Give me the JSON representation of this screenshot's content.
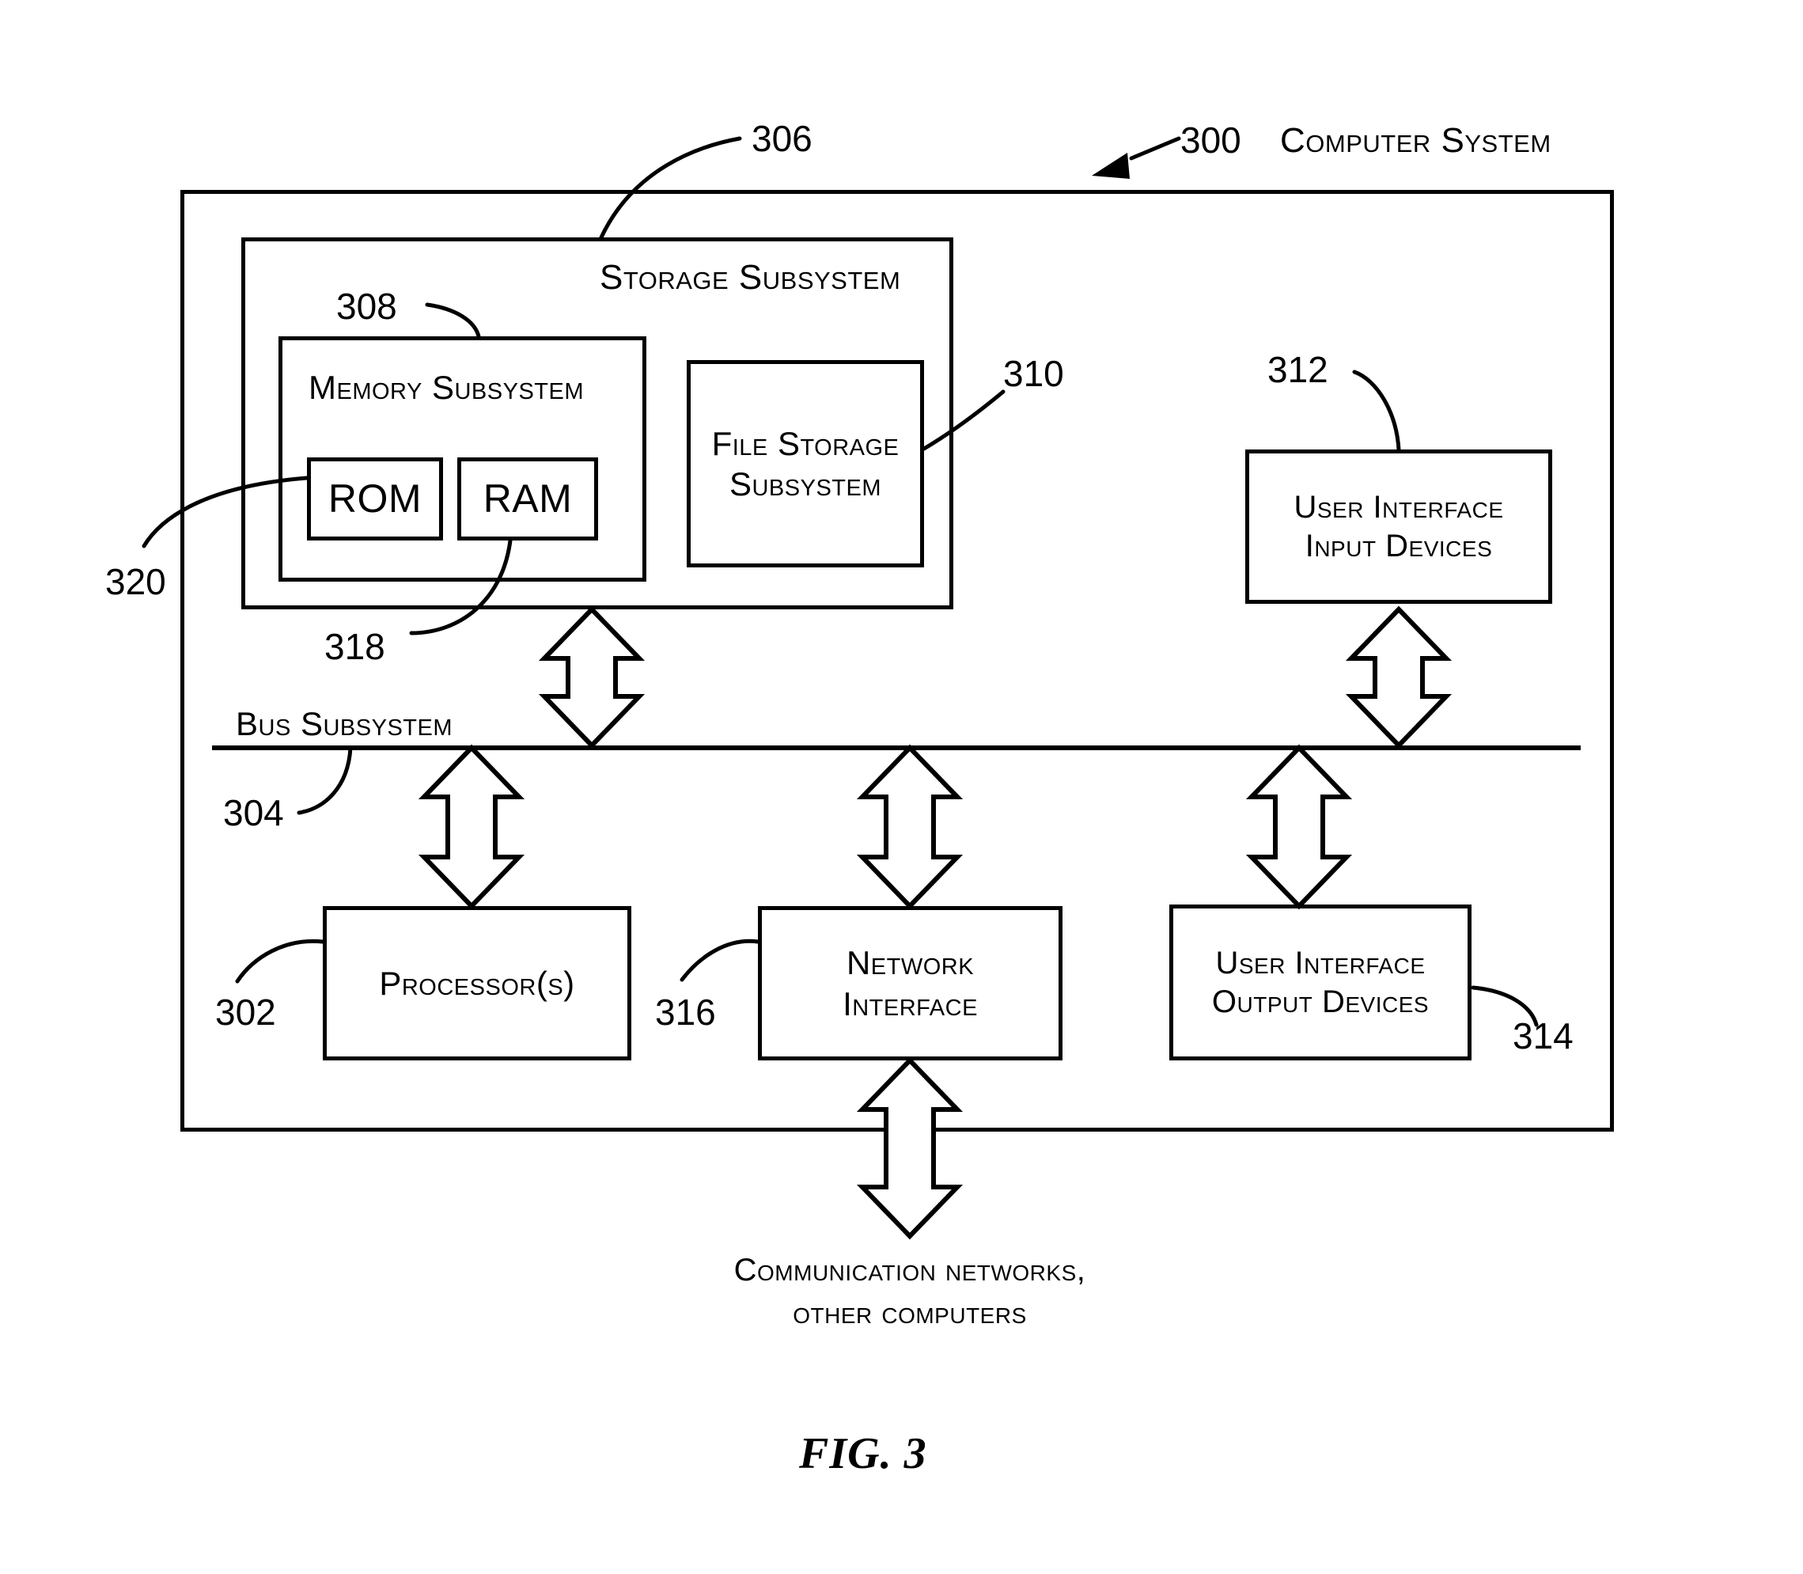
{
  "figure": {
    "caption": "FIG. 3",
    "title": "Computer System",
    "title_ref": "300"
  },
  "blocks": {
    "storage_subsystem": {
      "label": "Storage Subsystem",
      "ref": "306"
    },
    "memory_subsystem": {
      "label": "Memory Subsystem",
      "ref": "308"
    },
    "rom": {
      "label": "ROM",
      "ref": "320"
    },
    "ram": {
      "label": "RAM",
      "ref": "318"
    },
    "file_storage_subsystem": {
      "label": "File Storage\nSubsystem",
      "line1": "File Storage",
      "line2": "Subsystem",
      "ref": "310"
    },
    "ui_input_devices": {
      "line1": "User Interface",
      "line2": "Input Devices",
      "ref": "312"
    },
    "ui_output_devices": {
      "line1": "User Interface",
      "line2": "Output Devices",
      "ref": "314"
    },
    "bus_subsystem": {
      "label": "Bus Subsystem",
      "ref": "304"
    },
    "processors": {
      "label": "Processor(s)",
      "ref": "302"
    },
    "network_interface": {
      "line1": "Network",
      "line2": "Interface",
      "ref": "316"
    }
  },
  "external": {
    "line1": "Communication networks,",
    "line2": "other computers"
  },
  "colors": {
    "ink": "#000000",
    "paper": "#ffffff"
  }
}
